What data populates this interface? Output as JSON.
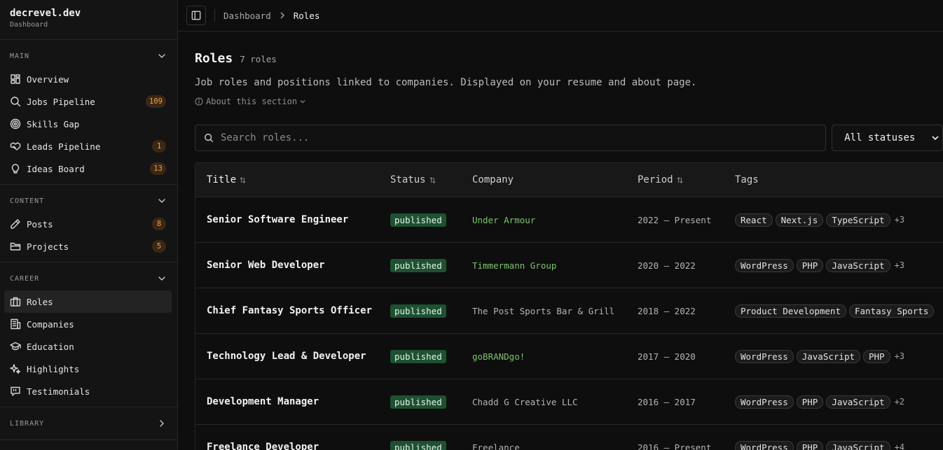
{
  "brand": {
    "name": "decrevel.dev",
    "subtitle": "Dashboard"
  },
  "sidebar": {
    "sections": [
      {
        "title": "MAIN",
        "expanded": true,
        "items": [
          {
            "label": "Overview",
            "icon": "grid-icon",
            "badge": ""
          },
          {
            "label": "Jobs Pipeline",
            "icon": "search-icon",
            "badge": "109"
          },
          {
            "label": "Skills Gap",
            "icon": "target-icon",
            "badge": ""
          },
          {
            "label": "Leads Pipeline",
            "icon": "handshake-icon",
            "badge": "1"
          },
          {
            "label": "Ideas Board",
            "icon": "lightbulb-icon",
            "badge": "13"
          }
        ]
      },
      {
        "title": "CONTENT",
        "expanded": true,
        "items": [
          {
            "label": "Posts",
            "icon": "pen-icon",
            "badge": "8"
          },
          {
            "label": "Projects",
            "icon": "folder-icon",
            "badge": "5"
          }
        ]
      },
      {
        "title": "CAREER",
        "expanded": true,
        "items": [
          {
            "label": "Roles",
            "icon": "briefcase-icon",
            "badge": "",
            "active": true
          },
          {
            "label": "Companies",
            "icon": "building-icon",
            "badge": ""
          },
          {
            "label": "Education",
            "icon": "graduation-cap-icon",
            "badge": ""
          },
          {
            "label": "Highlights",
            "icon": "sparkles-icon",
            "badge": ""
          },
          {
            "label": "Testimonials",
            "icon": "quote-icon",
            "badge": ""
          }
        ]
      },
      {
        "title": "LIBRARY",
        "expanded": false,
        "items": []
      }
    ]
  },
  "breadcrumb": {
    "parent": "Dashboard",
    "current": "Roles"
  },
  "page": {
    "title": "Roles",
    "count": "7 roles",
    "description": "Job roles and positions linked to companies. Displayed on your resume and about page.",
    "about_label": "About this section"
  },
  "search": {
    "placeholder": "Search roles...",
    "value": ""
  },
  "status_filter": {
    "selected": "All statuses"
  },
  "table": {
    "headers": {
      "title": "Title",
      "status": "Status",
      "company": "Company",
      "period": "Period",
      "tags": "Tags"
    },
    "rows": [
      {
        "title": "Senior Software Engineer",
        "status": "published",
        "company": "Under Armour",
        "company_linked": true,
        "period": "2022 – Present",
        "tags": [
          "React",
          "Next.js",
          "TypeScript"
        ],
        "more": "+3"
      },
      {
        "title": "Senior Web Developer",
        "status": "published",
        "company": "Timmermann Group",
        "company_linked": true,
        "period": "2020 – 2022",
        "tags": [
          "WordPress",
          "PHP",
          "JavaScript"
        ],
        "more": "+3"
      },
      {
        "title": "Chief Fantasy Sports Officer",
        "status": "published",
        "company": "The Post Sports Bar & Grill",
        "company_linked": false,
        "period": "2018 – 2022",
        "tags": [
          "Product Development",
          "Fantasy Sports"
        ],
        "more": ""
      },
      {
        "title": "Technology Lead & Developer",
        "status": "published",
        "company": "goBRANDgo!",
        "company_linked": true,
        "period": "2017 – 2020",
        "tags": [
          "WordPress",
          "JavaScript",
          "PHP"
        ],
        "more": "+3"
      },
      {
        "title": "Development Manager",
        "status": "published",
        "company": "Chadd G Creative LLC",
        "company_linked": false,
        "period": "2016 – 2017",
        "tags": [
          "WordPress",
          "PHP",
          "JavaScript"
        ],
        "more": "+2"
      },
      {
        "title": "Freelance Developer",
        "status": "published",
        "company": "Freelance",
        "company_linked": false,
        "period": "2016 – Present",
        "tags": [
          "WordPress",
          "PHP",
          "JavaScript"
        ],
        "more": "+4"
      }
    ]
  },
  "colors": {
    "badge_text": "#f0a340",
    "status_bg": "#1d5131",
    "company_link": "#7cc36d"
  }
}
